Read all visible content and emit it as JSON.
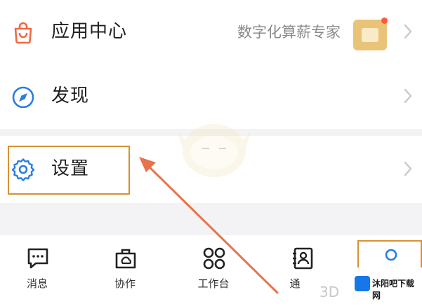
{
  "menu": {
    "app_center": {
      "label": "应用中心",
      "extra": "数字化算薪专家",
      "icon": "shopping-bag-icon"
    },
    "discover": {
      "label": "发现",
      "icon": "compass-icon"
    },
    "settings": {
      "label": "设置",
      "icon": "gear-icon"
    }
  },
  "tabs": [
    {
      "label": "消息",
      "icon": "chat-bubble-icon"
    },
    {
      "label": "协作",
      "icon": "collaboration-icon"
    },
    {
      "label": "工作台",
      "icon": "grid-icon"
    },
    {
      "label": "通",
      "icon": "contacts-icon"
    },
    {
      "label": "",
      "icon": "profile-icon"
    }
  ],
  "watermark": {
    "site": "沐阳吧下载网",
    "mark": "3D"
  },
  "colors": {
    "accent": "#2a7de1",
    "highlight": "#d99030",
    "arrow": "#e8734a",
    "bag": "#ee6a45"
  }
}
